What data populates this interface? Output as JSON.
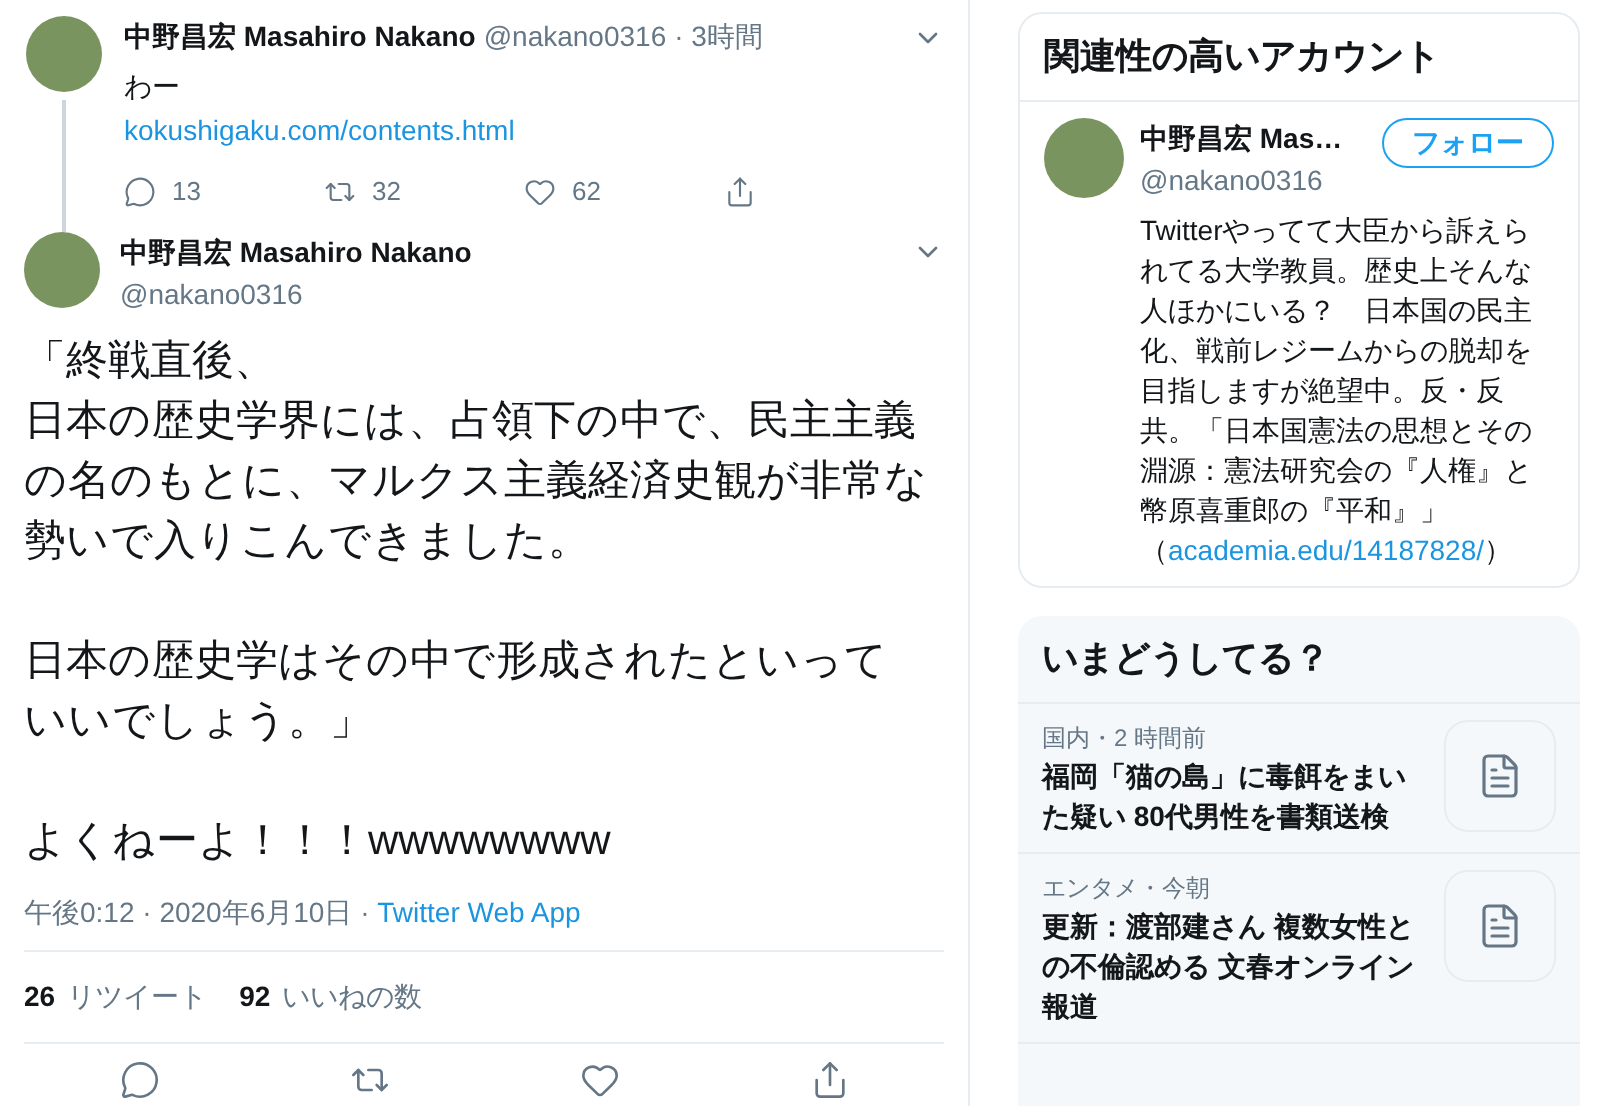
{
  "thread_tweet": {
    "name": "中野昌宏 Masahiro Nakano",
    "handle": "@nakano0316",
    "time": "· 3時間",
    "text": "わー",
    "link": "kokushigaku.com/contents.html",
    "actions": [
      {
        "kind": "reply",
        "count": "13"
      },
      {
        "kind": "retweet",
        "count": "32"
      },
      {
        "kind": "like",
        "count": "62"
      },
      {
        "kind": "share"
      }
    ]
  },
  "main_tweet": {
    "name": "中野昌宏 Masahiro Nakano",
    "handle": "@nakano0316",
    "paragraphs": [
      [
        "「終戦直後、",
        "日本の歴史学界には、占領下の中で、民主主義の名のもとに、マルクス主義経済史観が非常な勢いで入りこんできました。"
      ],
      [
        "日本の歴史学はその中で形成されたといっていいでしょう。」"
      ],
      [
        "よくねーよ！！！wwwwwwww"
      ]
    ],
    "timestamp": "午後0:12 · 2020年6月10日 · ",
    "source": "Twitter Web App",
    "stats": [
      {
        "count": "26",
        "label": "リツイート"
      },
      {
        "count": "92",
        "label": "いいねの数"
      }
    ],
    "actions": [
      {
        "kind": "reply"
      },
      {
        "kind": "retweet"
      },
      {
        "kind": "like"
      },
      {
        "kind": "share"
      }
    ]
  },
  "related": {
    "title": "関連性の高いアカウント",
    "name": "中野昌宏 Mas…",
    "handle": "@nakano0316",
    "follow": "フォロー",
    "bio": "Twitterやってて大臣から訴えられてる大学教員。歴史上そんな人ほかにいる？　日本国の民主化、戦前レジームからの脱却を目指しますが絶望中。反・反共。「日本国憲法の思想とその淵源：憲法研究会の『人権』と幣原喜重郎の『平和』」（",
    "bio_link": "academia.edu/14187828/",
    "bio_tail": "）"
  },
  "trends": {
    "title": "いまどうしてる？",
    "items": [
      {
        "meta": "国内・2 時間前",
        "headline": "福岡「猫の島」に毒餌をまいた疑い 80代男性を書類送検"
      },
      {
        "meta": "エンタメ・今朝",
        "headline": "更新：渡部建さん 複数女性との不倫認める 文春オンライン報道"
      }
    ]
  }
}
